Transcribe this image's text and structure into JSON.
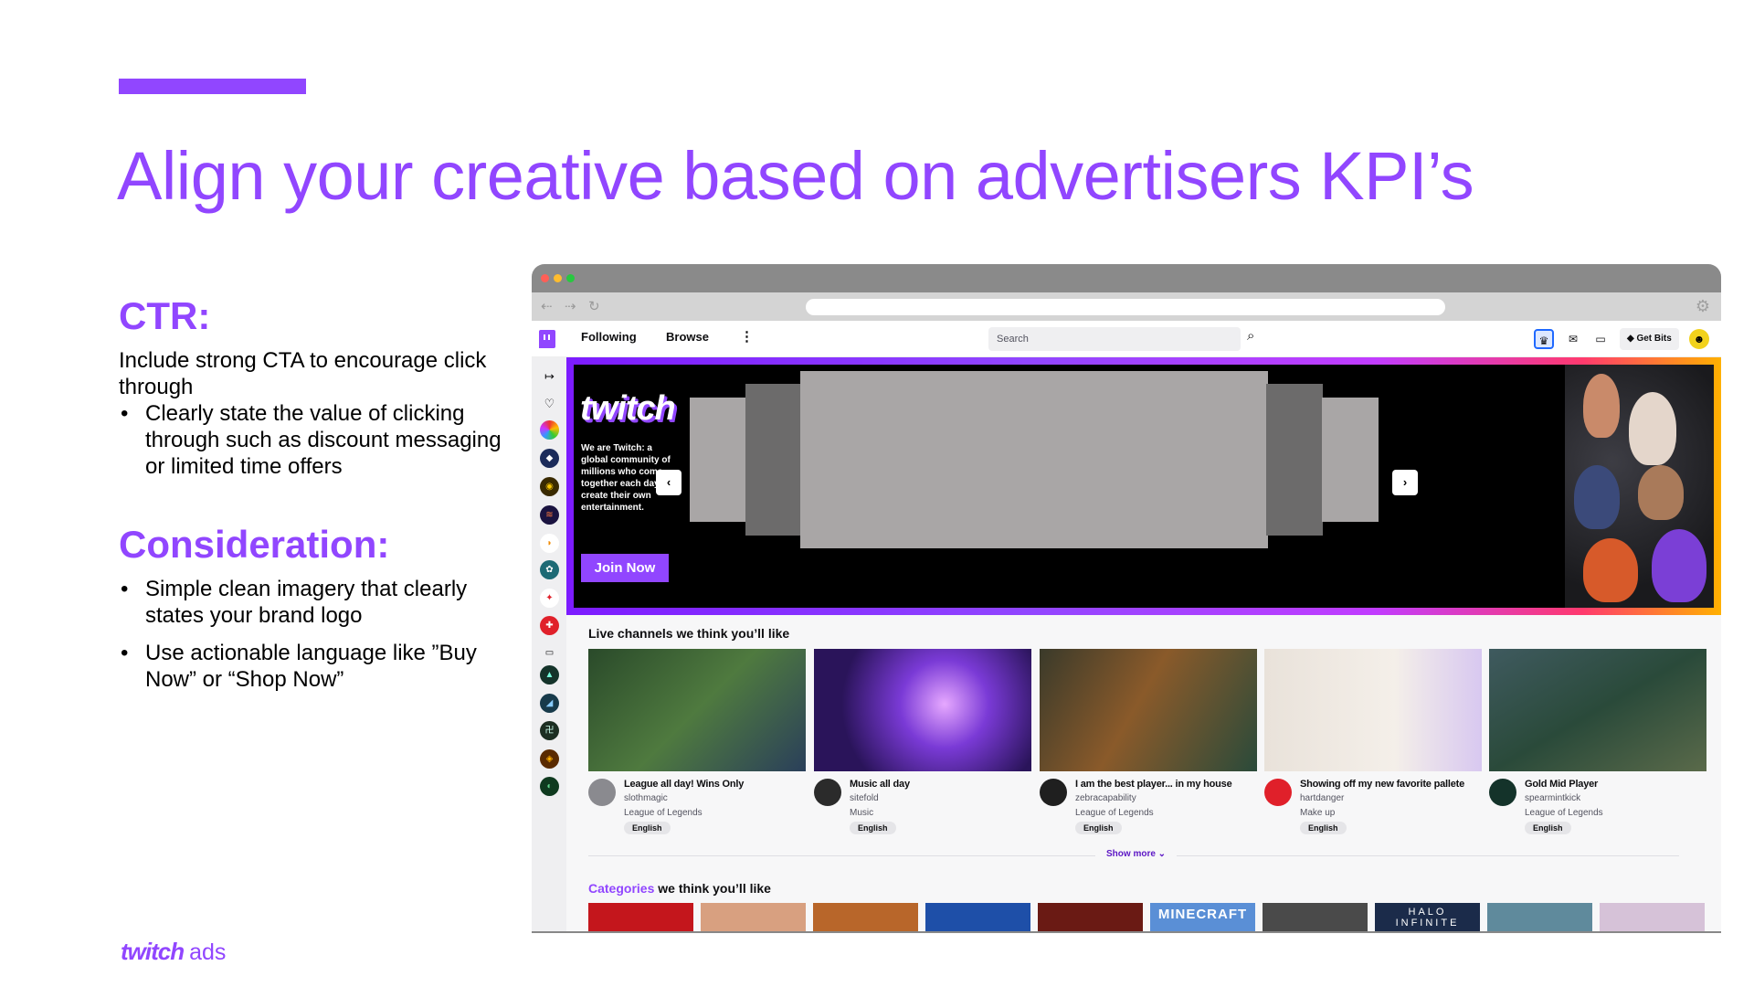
{
  "slide": {
    "title": "Align your creative based on advertisers KPI’s",
    "ctr": {
      "heading": "CTR:",
      "intro": "Include strong CTA to encourage click through",
      "bullets": [
        "Clearly state the value of clicking through such as discount messaging or limited time offers"
      ]
    },
    "consideration": {
      "heading": "Consideration:",
      "bullets": [
        "Simple clean imagery that clearly states your brand logo",
        "Use actionable language like ”Buy Now” or “Shop Now”"
      ]
    },
    "footer": {
      "brand": "twitch",
      "suffix": "ads"
    },
    "colors": {
      "accent": "#9146ff",
      "text": "#000000"
    }
  },
  "browser": {
    "window_dots": [
      "#ff5f57",
      "#febc2e",
      "#28c840"
    ],
    "nav_icons": [
      "back-arrow-icon",
      "forward-arrow-icon",
      "reload-icon"
    ],
    "top_nav": {
      "following": "Following",
      "browse": "Browse",
      "more": "⋮",
      "search_placeholder": "Search",
      "get_bits": "Get Bits"
    },
    "hero": {
      "brand": "twitch",
      "copy": "We are Twitch: a global community of millions who come together each day to create their own entertainment.",
      "cta": "Join Now",
      "prev": "‹",
      "next": "›"
    },
    "live_section": {
      "title": "Live channels we think you’ll like",
      "channels": [
        {
          "title": "League all day! Wins Only",
          "name": "slothmagic",
          "category": "League of Legends",
          "tag": "English",
          "avatar_color": "#8a8a8f",
          "thumb": "#3d6b3a"
        },
        {
          "title": "Music all day",
          "name": "sitefold",
          "category": "Music",
          "tag": "English",
          "avatar_color": "#2b2b2b",
          "thumb": "#5a3fb3"
        },
        {
          "title": "I am the best player... in my house",
          "name": "zebracapability",
          "category": "League of Legends",
          "tag": "English",
          "avatar_color": "#1f1f1f",
          "thumb": "#6b5a2e"
        },
        {
          "title": "Showing off my new favorite pallete",
          "name": "hartdanger",
          "category": "Make up",
          "tag": "English",
          "avatar_color": "#e0202a",
          "thumb": "#efe8e2"
        },
        {
          "title": "Gold Mid Player",
          "name": "spearmintkick",
          "category": "League of Legends",
          "tag": "English",
          "avatar_color": "#14332a",
          "thumb": "#2f4f4a"
        }
      ],
      "show_more": "Show more ⌄"
    },
    "categories_section": {
      "highlight": "Categories",
      "rest": " we think you’ll like",
      "tiles": [
        {
          "label": "",
          "color": "#c4161c"
        },
        {
          "label": "",
          "color": "#d8a080"
        },
        {
          "label": "",
          "color": "#b8662a"
        },
        {
          "label": "",
          "color": "#1e4fa8"
        },
        {
          "label": "",
          "color": "#6a1a14"
        },
        {
          "label": "MINECRAFT",
          "color": "#5a8fd6"
        },
        {
          "label": "",
          "color": "#4a4a4a"
        },
        {
          "label": "HALO INFINITE",
          "color": "#1b2b4a"
        },
        {
          "label": "",
          "color": "#5f8a9c"
        },
        {
          "label": "",
          "color": "#d6c2d8"
        }
      ]
    },
    "side_rail": {
      "icons": [
        "collapse-icon",
        "heart-icon",
        "channel-avatar-icon",
        "channel-avatar-icon",
        "channel-avatar-icon",
        "channel-avatar-icon",
        "channel-avatar-icon",
        "channel-avatar-icon",
        "channel-avatar-icon",
        "channel-avatar-icon",
        "video-camera-icon",
        "channel-avatar-icon",
        "channel-avatar-icon",
        "channel-avatar-icon",
        "channel-avatar-icon",
        "channel-avatar-icon"
      ]
    }
  }
}
